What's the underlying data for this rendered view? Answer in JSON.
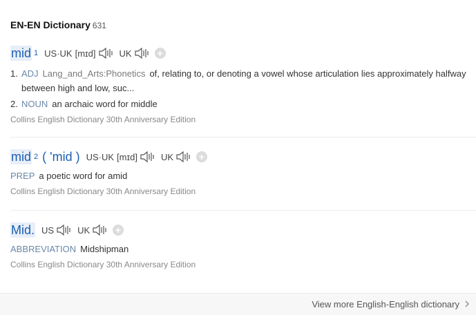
{
  "header": {
    "title": "EN-EN Dictionary",
    "count": "631"
  },
  "entries": [
    {
      "word": "mid",
      "sup": "1",
      "region1": "US·UK",
      "phon1": "[mɪd]",
      "region2": "UK",
      "senses": [
        {
          "num": "1.",
          "pos": "ADJ",
          "field": "Lang_and_Arts:Phonetics",
          "def": "of, relating to, or denoting a vowel whose articulation lies approximately halfway between high and low, suc..."
        },
        {
          "num": "2.",
          "pos": "NOUN",
          "def": "an archaic word for middle"
        }
      ],
      "source": "Collins English Dictionary 30th Anniversary Edition"
    },
    {
      "word": "mid",
      "sup": "2",
      "pron": "( 'mid )",
      "region1": "US·UK",
      "phon1": "[mɪd]",
      "region2": "UK",
      "senses": [
        {
          "pos": "PREP",
          "def": "a poetic word for amid"
        }
      ],
      "source": "Collins English Dictionary 30th Anniversary Edition"
    },
    {
      "word": "Mid.",
      "region1": "US",
      "region2": "UK",
      "senses": [
        {
          "pos": "ABBREVIATION",
          "def": "Midshipman"
        }
      ],
      "source": "Collins English Dictionary 30th Anniversary Edition"
    }
  ],
  "footer": {
    "more_label": "View more English-English dictionary"
  },
  "icons": {
    "speaker": "speaker-icon",
    "add": "add-icon",
    "chevron": "chevron-right-icon"
  },
  "colors": {
    "link": "#1a5fb4",
    "pos": "#6a87a8",
    "muted": "#888888"
  }
}
